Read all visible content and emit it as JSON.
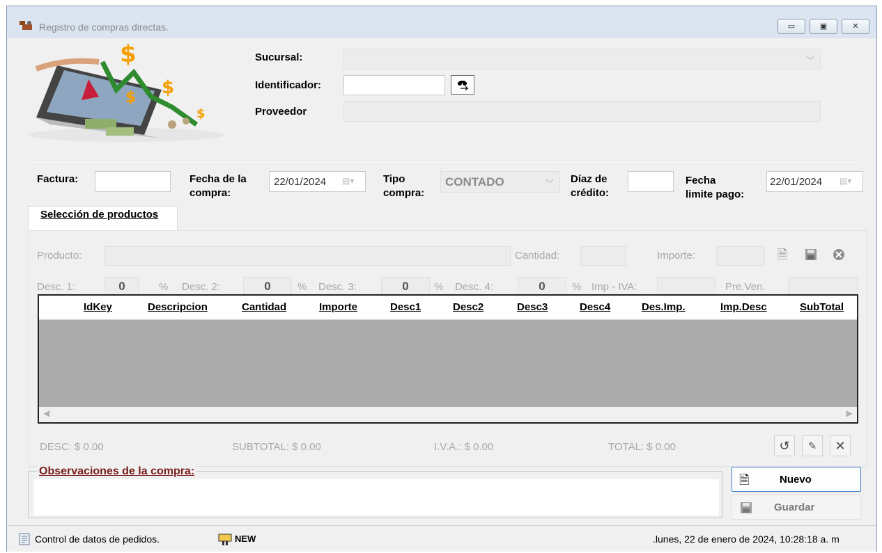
{
  "window": {
    "title": "Registro de compras directas.",
    "minimize_glyph": "▭",
    "restore_glyph": "▣",
    "close_glyph": "✕"
  },
  "header": {
    "sucursal_label": "Sucursal:",
    "sucursal_value": "",
    "identificador_label": "Identificador:",
    "identificador_value": "",
    "proveedor_label": "Proveedor",
    "proveedor_value": ""
  },
  "invoice": {
    "factura_label": "Factura:",
    "factura_value": "",
    "fecha_compra_label_1": "Fecha de la",
    "fecha_compra_label_2": "compra:",
    "fecha_compra_value": "22/01/2024",
    "tipo_compra_label_1": "Tipo",
    "tipo_compra_label_2": "compra:",
    "tipo_compra_value": "CONTADO",
    "dias_credito_label_1": "Díaz de",
    "dias_credito_label_2": "crédito:",
    "dias_credito_value": "",
    "fecha_limite_label_1": "Fecha",
    "fecha_limite_label_2": "limite pago:",
    "fecha_limite_value": "22/01/2024"
  },
  "tabs": [
    {
      "label": "Selección de productos"
    }
  ],
  "product_entry": {
    "producto_label": "Producto:",
    "cantidad_label": "Cantidad:",
    "importe_label": "Importe:",
    "desc1_label": "Desc. 1:",
    "desc1_value": "0",
    "desc2_label": "Desc. 2:",
    "desc2_value": "0",
    "desc3_label": "Desc. 3:",
    "desc3_value": "0",
    "desc4_label": "Desc. 4:",
    "desc4_value": "0",
    "percent": "%",
    "imp_iva_label": "Imp - IVA:",
    "pre_ven_label": "Pre.Ven."
  },
  "grid": {
    "columns": [
      "IdKey",
      "Descripcion",
      "Cantidad",
      "Importe",
      "Desc1",
      "Desc2",
      "Desc3",
      "Desc4",
      "Des.Imp.",
      "Imp.Desc",
      "SubTotal"
    ],
    "rows": []
  },
  "totals": {
    "desc": "DESC: $ 0.00",
    "subtotal": "SUBTOTAL: $ 0.00",
    "iva": "I.V.A.:  $ 0.00",
    "total": "TOTAL:  $ 0.00"
  },
  "observaciones": {
    "label": "Observaciones de la compra:",
    "value": ""
  },
  "actions": {
    "nuevo_label": "Nuevo",
    "guardar_label": "Guardar"
  },
  "status": {
    "left_text": "Control de datos de pedidos.",
    "new_badge": "NEW",
    "datetime": ".lunes, 22 de enero de 2024, 10:28:18 a. m"
  },
  "colors": {
    "title_bar": "#dbe5f1",
    "grid_body": "#ababab",
    "obs_label": "#7b1c1c",
    "accent_border": "#3d7ecf"
  }
}
